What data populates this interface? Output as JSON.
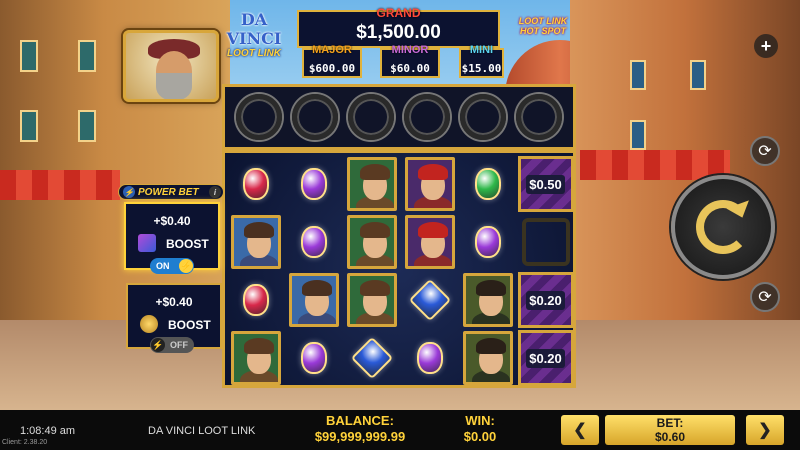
{
  "game": {
    "logo_line1": "DA VINCI",
    "logo_line2": "LOOT LINK",
    "logo2_line1": "LOOT LINK",
    "logo2_line2": "HOT SPOT"
  },
  "jackpots": {
    "grand": {
      "label": "GRAND",
      "value": "$1,500.00"
    },
    "major": {
      "label": "MAJOR",
      "value": "$600.00"
    },
    "minor": {
      "label": "MINOR",
      "value": "$60.00"
    },
    "mini": {
      "label": "MINI",
      "value": "$15.00"
    }
  },
  "power_bet": {
    "title": "POWER BET",
    "info_icon": "info-icon",
    "boosts": [
      {
        "amount": "+$0.40",
        "label": "BOOST",
        "state": "ON",
        "icon": "gem-boost-icon"
      },
      {
        "amount": "+$0.40",
        "label": "BOOST",
        "state": "OFF",
        "icon": "coin-boost-icon"
      }
    ]
  },
  "grid": {
    "ring_count": 6,
    "cells": [
      [
        "gem-red",
        "gem-purple",
        "portrait-lady",
        "portrait-man",
        "gem-green",
        "cash"
      ],
      [
        "portrait-lady-bun",
        "gem-purple",
        "portrait-lady",
        "portrait-man",
        "gem-purple",
        "empty"
      ],
      [
        "gem-red",
        "portrait-lady-bun",
        "portrait-lady",
        "gem-blue",
        "portrait-mona",
        "cash"
      ],
      [
        "portrait-lady",
        "gem-purple",
        "gem-blue",
        "gem-purple",
        "portrait-mona",
        "cash"
      ]
    ],
    "cash_values": [
      "$0.50",
      "$0.20",
      "$0.20"
    ]
  },
  "controls": {
    "plus_icon": "+",
    "autoplay_icon": "⟳",
    "turbo_icon": "⟳"
  },
  "status_bar": {
    "time": "1:08:49 am",
    "client": "Client: 2.38.20",
    "game_title": "DA VINCI LOOT LINK",
    "balance_label": "BALANCE:",
    "balance_value": "$99,999,999.99",
    "win_label": "WIN:",
    "win_value": "$0.00",
    "bet_label": "BET:",
    "bet_value": "$0.60",
    "bet_prev": "❮",
    "bet_next": "❯"
  },
  "colors": {
    "gold": "#d6a63c",
    "accent_yellow": "#ffd23a",
    "panel_bg": "#0c1230",
    "toggle_on": "#1f7ed0"
  }
}
